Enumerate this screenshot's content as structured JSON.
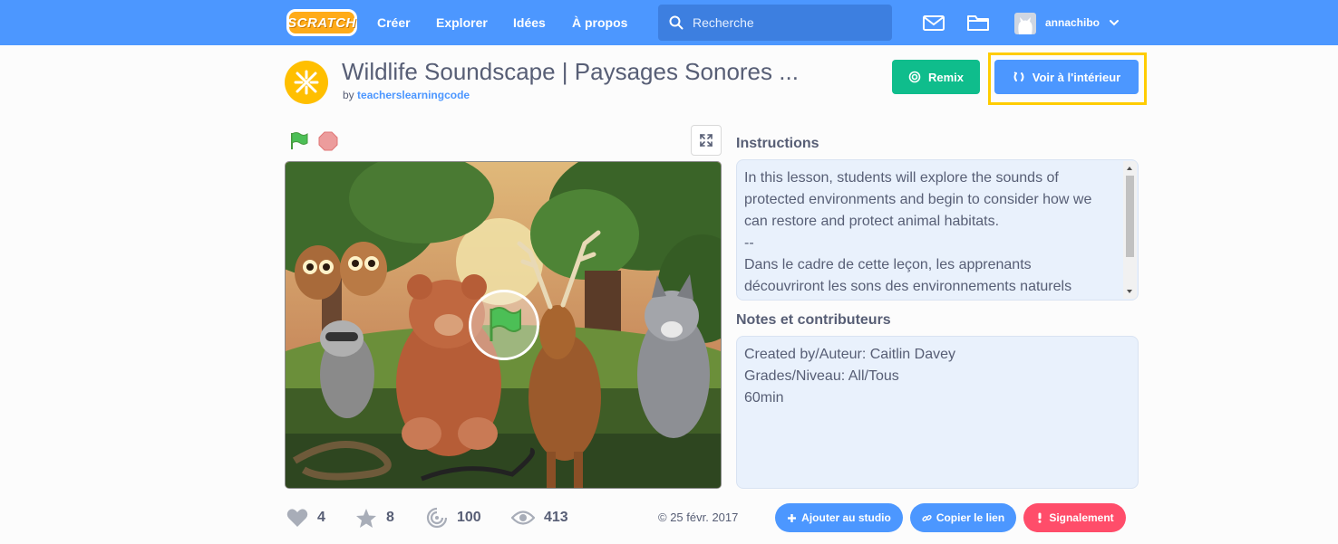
{
  "nav": {
    "logo": "SCRATCH",
    "links": [
      "Créer",
      "Explorer",
      "Idées",
      "À propos"
    ],
    "search_placeholder": "Recherche",
    "username": "annachibo",
    "color": "#4c97ff"
  },
  "project": {
    "title": "Wildlife Soundscape | Paysages Sonores ...",
    "by_prefix": "by",
    "author": "teacherslearningcode",
    "remix_label": "Remix",
    "see_inside_label": "Voir à l'intérieur"
  },
  "instructions": {
    "heading": "Instructions",
    "text": "In this lesson, students will explore the sounds of protected environments and begin to consider how we can restore and protect animal habitats.\n--\nDans le cadre de cette leçon, les apprenants découvriront les sons des environnements naturels"
  },
  "notes": {
    "heading": "Notes et contributeurs",
    "text": "Created by/Auteur: Caitlin Davey\nGrades/Niveau: All/Tous\n60min"
  },
  "stats": {
    "loves": "4",
    "favorites": "8",
    "remixes": "100",
    "views": "413"
  },
  "date": "© 25 févr. 2017",
  "actions": {
    "add_to_studio": "Ajouter au studio",
    "copy_link": "Copier le lien",
    "report": "Signalement"
  },
  "icons": [
    "search-icon",
    "messages-icon",
    "my-stuff-icon",
    "chevron-down-icon",
    "remix-icon",
    "see-inside-icon",
    "green-flag-icon",
    "stop-icon",
    "fullscreen-icon",
    "heart-icon",
    "star-icon",
    "remix-count-icon",
    "eye-icon",
    "plus-icon",
    "link-icon",
    "flag-report-icon"
  ]
}
